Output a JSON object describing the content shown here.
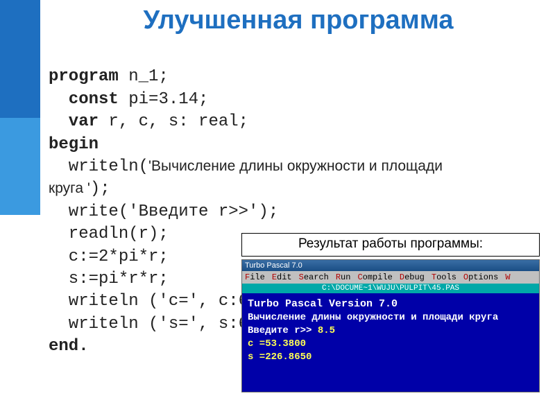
{
  "title": "Улучшенная программа",
  "code": {
    "l1a": "program",
    "l1b": " n_1;",
    "l2a": "  const",
    "l2b": " pi=3.14;",
    "l3a": "  var",
    "l3b": " r, c, s: real;",
    "l4": "begin",
    "l5a": "  writeln(",
    "l5b": "'Вычисление длины окружности и площади",
    "l5c": "круга '",
    "l5d": ");",
    "l6": "  write('Введите r>>');",
    "l7": "  readln(r);",
    "l8": "  c:=2*pi*r;",
    "l9": "  s:=pi*r*r;",
    "l10": "  writeln ('c=', c:6:",
    "l11": "  writeln ('s=', s:6:",
    "l12": "end."
  },
  "result_label": "Результат работы программы:",
  "turbo": {
    "titlebar": "Turbo Pascal 7.0",
    "menu": [
      "File",
      "Edit",
      "Search",
      "Run",
      "Compile",
      "Debug",
      "Tools",
      "Options",
      "W"
    ],
    "path": "C:\\DOCUME~1\\WUJU\\PULPIT\\45.PAS",
    "header": "Turbo Pascal   Version 7.0",
    "line1": "Вычисление длины окружности и площади круга",
    "line2a": "Введите r>> ",
    "line2b": "8.5",
    "line3": "c  =53.3800",
    "line4": "s  =226.8650"
  }
}
